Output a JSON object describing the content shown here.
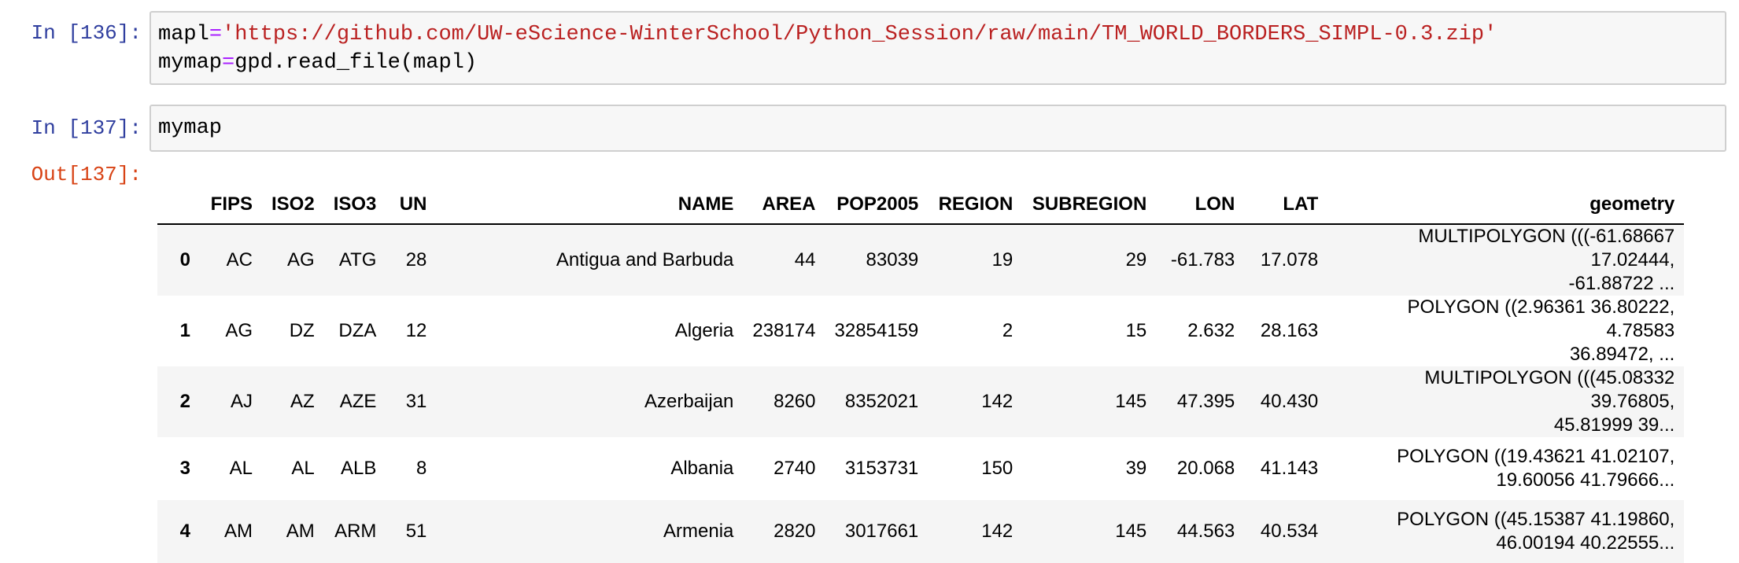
{
  "cells": [
    {
      "prompt": "In [136]:",
      "code": {
        "line1": {
          "var": "mapl",
          "op": "=",
          "str": "'https://github.com/UW-eScience-WinterSchool/Python_Session/raw/main/TM_WORLD_BORDERS_SIMPL-0.3.zip'"
        },
        "line2": {
          "var": "mymap",
          "op": "=",
          "rest": "gpd.read_file(mapl)"
        }
      }
    },
    {
      "prompt": "In [137]:",
      "code": "mymap"
    }
  ],
  "output": {
    "prompt": "Out[137]:",
    "columns": [
      "",
      "FIPS",
      "ISO2",
      "ISO3",
      "UN",
      "NAME",
      "AREA",
      "POP2005",
      "REGION",
      "SUBREGION",
      "LON",
      "LAT",
      "geometry"
    ],
    "rows": [
      {
        "index": "0",
        "FIPS": "AC",
        "ISO2": "AG",
        "ISO3": "ATG",
        "UN": "28",
        "NAME": "Antigua and Barbuda",
        "AREA": "44",
        "POP2005": "83039",
        "REGION": "19",
        "SUBREGION": "29",
        "LON": "-61.783",
        "LAT": "17.078",
        "geometry_l1": "MULTIPOLYGON (((-61.68667 17.02444,",
        "geometry_l2": "-61.88722 ..."
      },
      {
        "index": "1",
        "FIPS": "AG",
        "ISO2": "DZ",
        "ISO3": "DZA",
        "UN": "12",
        "NAME": "Algeria",
        "AREA": "238174",
        "POP2005": "32854159",
        "REGION": "2",
        "SUBREGION": "15",
        "LON": "2.632",
        "LAT": "28.163",
        "geometry_l1": "POLYGON ((2.96361 36.80222, 4.78583",
        "geometry_l2": "36.89472, ..."
      },
      {
        "index": "2",
        "FIPS": "AJ",
        "ISO2": "AZ",
        "ISO3": "AZE",
        "UN": "31",
        "NAME": "Azerbaijan",
        "AREA": "8260",
        "POP2005": "8352021",
        "REGION": "142",
        "SUBREGION": "145",
        "LON": "47.395",
        "LAT": "40.430",
        "geometry_l1": "MULTIPOLYGON (((45.08332 39.76805,",
        "geometry_l2": "45.81999 39..."
      },
      {
        "index": "3",
        "FIPS": "AL",
        "ISO2": "AL",
        "ISO3": "ALB",
        "UN": "8",
        "NAME": "Albania",
        "AREA": "2740",
        "POP2005": "3153731",
        "REGION": "150",
        "SUBREGION": "39",
        "LON": "20.068",
        "LAT": "41.143",
        "geometry_l1": "POLYGON ((19.43621 41.02107,",
        "geometry_l2": "19.60056 41.79666..."
      },
      {
        "index": "4",
        "FIPS": "AM",
        "ISO2": "AM",
        "ISO3": "ARM",
        "UN": "51",
        "NAME": "Armenia",
        "AREA": "2820",
        "POP2005": "3017661",
        "REGION": "142",
        "SUBREGION": "145",
        "LON": "44.563",
        "LAT": "40.534",
        "geometry_l1": "POLYGON ((45.15387 41.19860,",
        "geometry_l2": "46.00194 40.22555..."
      }
    ]
  }
}
